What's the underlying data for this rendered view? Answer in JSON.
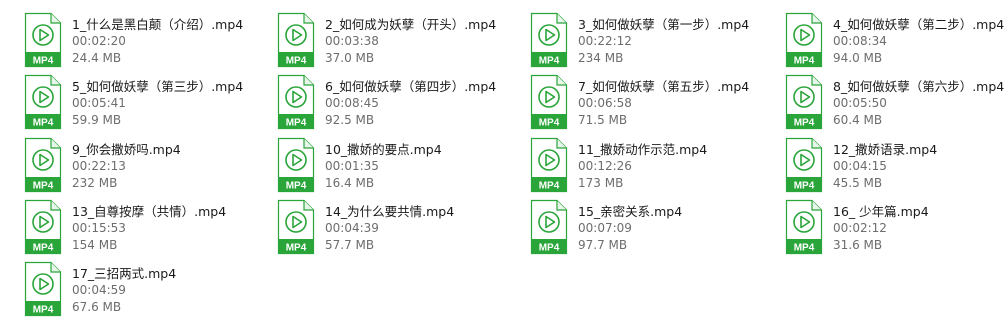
{
  "icon_type": "mp4-video-file-icon",
  "colors": {
    "accent": "#2aa53a",
    "name_text": "#1a1a1a",
    "meta_text": "#6d6d6d"
  },
  "files": [
    {
      "name": "1_什么是黑白颠（介绍）.mp4",
      "duration": "00:02:20",
      "size": "24.4 MB",
      "badge": "MP4"
    },
    {
      "name": "2_如何成为妖孽（开头）.mp4",
      "duration": "00:03:38",
      "size": "37.0 MB",
      "badge": "MP4"
    },
    {
      "name": "3_如何做妖孽（第一步）.mp4",
      "duration": "00:22:12",
      "size": "234 MB",
      "badge": "MP4"
    },
    {
      "name": "4_如何做妖孽（第二步）.mp4",
      "duration": "00:08:34",
      "size": "94.0 MB",
      "badge": "MP4"
    },
    {
      "name": "5_如何做妖孽（第三步）.mp4",
      "duration": "00:05:41",
      "size": "59.9 MB",
      "badge": "MP4"
    },
    {
      "name": "6_如何做妖孽（第四步）.mp4",
      "duration": "00:08:45",
      "size": "92.5 MB",
      "badge": "MP4"
    },
    {
      "name": "7_如何做妖孽（第五步）.mp4",
      "duration": "00:06:58",
      "size": "71.5 MB",
      "badge": "MP4"
    },
    {
      "name": "8_如何做妖孽（第六步）.mp4",
      "duration": "00:05:50",
      "size": "60.4 MB",
      "badge": "MP4"
    },
    {
      "name": "9_你会撒娇吗.mp4",
      "duration": "00:22:13",
      "size": "232 MB",
      "badge": "MP4"
    },
    {
      "name": "10_撒娇的要点.mp4",
      "duration": "00:01:35",
      "size": "16.4 MB",
      "badge": "MP4"
    },
    {
      "name": "11_撒娇动作示范.mp4",
      "duration": "00:12:26",
      "size": "173 MB",
      "badge": "MP4"
    },
    {
      "name": "12_撒娇语录.mp4",
      "duration": "00:04:15",
      "size": "45.5 MB",
      "badge": "MP4"
    },
    {
      "name": "13_自尊按摩（共情）.mp4",
      "duration": "00:15:53",
      "size": "154 MB",
      "badge": "MP4"
    },
    {
      "name": "14_为什么要共情.mp4",
      "duration": "00:04:39",
      "size": "57.7 MB",
      "badge": "MP4"
    },
    {
      "name": "15_亲密关系.mp4",
      "duration": "00:07:09",
      "size": "97.7 MB",
      "badge": "MP4"
    },
    {
      "name": "16_ 少年篇.mp4",
      "duration": "00:02:12",
      "size": "31.6 MB",
      "badge": "MP4"
    },
    {
      "name": "17_三招两式.mp4",
      "duration": "00:04:59",
      "size": "67.6 MB",
      "badge": "MP4"
    }
  ]
}
